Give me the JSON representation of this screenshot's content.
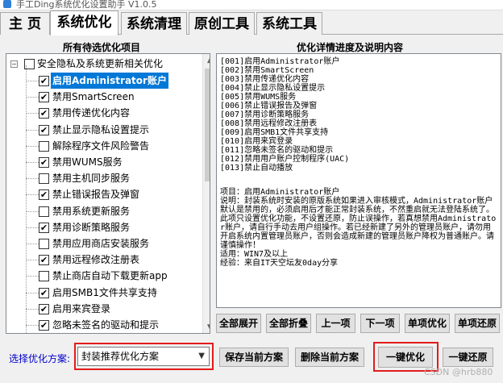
{
  "window": {
    "title": "手工Ding系统优化设置助手 V1.0.5"
  },
  "tabs": [
    {
      "label": "主 页"
    },
    {
      "label": "系统优化"
    },
    {
      "label": "系统清理"
    },
    {
      "label": "原创工具"
    },
    {
      "label": "系统工具"
    }
  ],
  "active_tab": "系统优化",
  "left_panel": {
    "title": "所有待选优化项目",
    "group": {
      "label": "安全隐私及系统更新相关优化",
      "expander": "−",
      "checked": false
    },
    "items": [
      {
        "label": "启用Administrator账户",
        "checked": true,
        "selected": true
      },
      {
        "label": "禁用SmartScreen",
        "checked": true
      },
      {
        "label": "禁用传递优化内容",
        "checked": true
      },
      {
        "label": "禁止显示隐私设置提示",
        "checked": true
      },
      {
        "label": "解除程序文件风险警告",
        "checked": false
      },
      {
        "label": "禁用WUMS服务",
        "checked": true
      },
      {
        "label": "禁用主机同步服务",
        "checked": false
      },
      {
        "label": "禁止错误报告及弹窗",
        "checked": true
      },
      {
        "label": "禁用系统更新服务",
        "checked": false
      },
      {
        "label": "禁用诊断策略服务",
        "checked": true
      },
      {
        "label": "禁用应用商店安装服务",
        "checked": false
      },
      {
        "label": "禁用远程修改注册表",
        "checked": true
      },
      {
        "label": "禁止商店自动下载更新app",
        "checked": false
      },
      {
        "label": "启用SMB1文件共享支持",
        "checked": true
      },
      {
        "label": "启用来宾登录",
        "checked": true
      },
      {
        "label": "忽略未签名的驱动和提示",
        "checked": true
      }
    ]
  },
  "right_panel": {
    "title": "优化详情进度及说明内容",
    "toc": [
      "[001]启用Administrator账户",
      "[002]禁用SmartScreen",
      "[003]禁用传递优化内容",
      "[004]禁止显示隐私设置提示",
      "[005]禁用WUMS服务",
      "[006]禁止错误报告及弹窗",
      "[007]禁用诊断策略服务",
      "[008]禁用远程修改注册表",
      "[009]启用SMB1文件共享支持",
      "[010]启用来宾登录",
      "[011]忽略未签名的驱动和提示",
      "[012]禁用用户账户控制程序(UAC)",
      "[013]禁止自动播放"
    ],
    "description": "项目：启用Administrator账户\n说明：封装系统时安装的原版系统如果进入审核模式，Administrator账户默认是禁用的，必须启用后才能正常封装系统，不然重启就无法登陆系统了。此项只设置优化功能，不设置还原，防止误操作，若真想禁用Administrator账户，请自行手动去用户组操作。若已经新建了另外的管理员账户，请勿用开启系统内置管理员账户，否则会造成新建的管理员账户降权为普通账户。请谨慎操作！\n适用：WIN7及以上\n经验：来自IT天空坛友0day分享"
  },
  "action_buttons": [
    {
      "label": "全部展开"
    },
    {
      "label": "全部折叠"
    },
    {
      "label": "上一项"
    },
    {
      "label": "下一项"
    },
    {
      "label": "单项优化"
    },
    {
      "label": "单项还原"
    }
  ],
  "bottom": {
    "scheme_label": "选择优化方案:",
    "scheme_value": "封装推荐优化方案",
    "save_label": "保存当前方案",
    "delete_label": "删除当前方案",
    "optimize_label": "一键优化",
    "restore_label": "一键还原"
  },
  "watermark": "CSDN @hrb880",
  "colors": {
    "selection": "#0078d7",
    "highlight_box": "#e31b1b",
    "scheme_label": "#0000cc"
  }
}
